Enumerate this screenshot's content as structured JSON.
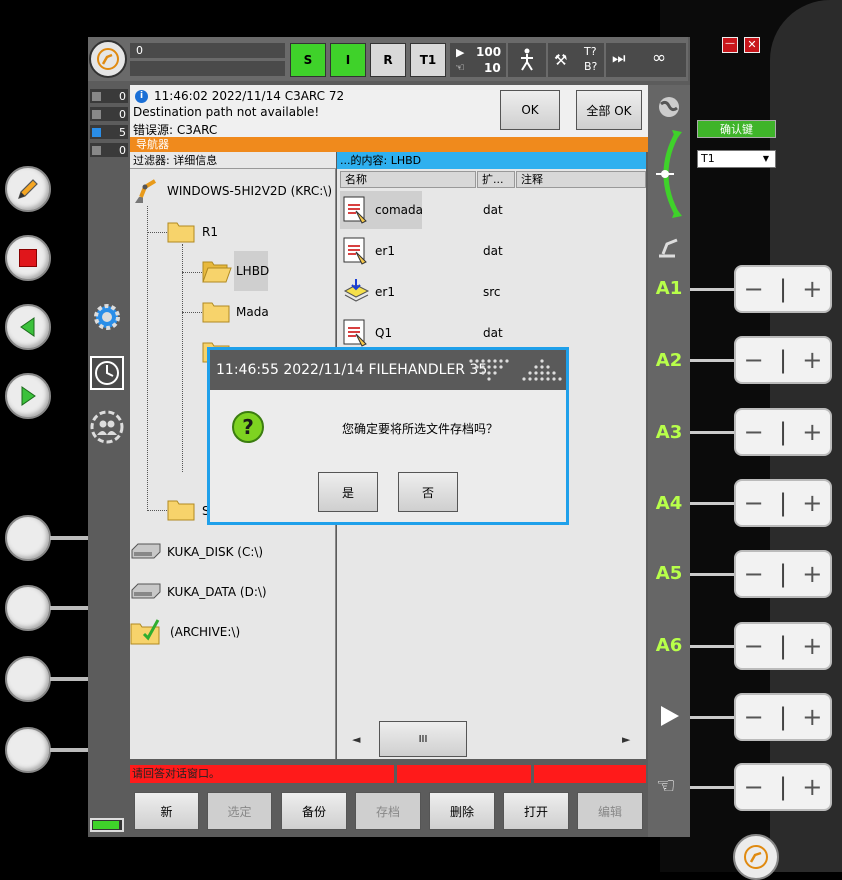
{
  "topbar": {
    "prog_field": "0",
    "btn_s": "S",
    "btn_i": "I",
    "btn_r": "R",
    "btn_t1": "T1",
    "override_prog": "100",
    "override_jog": "10",
    "tool_t": "T?",
    "tool_b": "B?",
    "infinity": "∞"
  },
  "counters": [
    {
      "icon": "info-icon",
      "value": "0"
    },
    {
      "icon": "warning-icon",
      "value": "0"
    },
    {
      "icon": "info-blue-icon",
      "value": "5"
    },
    {
      "icon": "dialog-icon",
      "value": "0"
    }
  ],
  "message": {
    "line1": "11:46:02 2022/11/14 C3ARC 72",
    "line2": "Destination path not available!",
    "line3": "错误源: C3ARC",
    "ok": "OK",
    "ok_all": "全部 OK"
  },
  "navigator": {
    "title": "导航器",
    "filter": "过滤器: 详细信息",
    "content": "...的内容: LHBD",
    "col_name": "名称",
    "col_ext": "扩...",
    "col_comment": "注释"
  },
  "tree": {
    "root": "WINDOWS-5HI2V2D (KRC:\\)",
    "r1": "R1",
    "lhbd": "LHBD",
    "mada": "Mada",
    "s_item": "S",
    "disk_c": "KUKA_DISK (C:\\)",
    "disk_d": "KUKA_DATA (D:\\)",
    "archive": "(ARCHIVE:\\)"
  },
  "files": [
    {
      "name": "comada",
      "ext": "dat"
    },
    {
      "name": "er1",
      "ext": "dat"
    },
    {
      "name": "er1",
      "ext": "src"
    },
    {
      "name": "Q1",
      "ext": "dat"
    }
  ],
  "scroll": {
    "thumb": "III",
    "left": "◄",
    "right": "►"
  },
  "status": {
    "text": "请回答对话窗口。"
  },
  "buttons": {
    "new": "新",
    "select": "选定",
    "backup": "备份",
    "archive": "存档",
    "delete": "删除",
    "open": "打开",
    "edit": "编辑"
  },
  "dialog": {
    "title": "11:46:55 2022/11/14 FILEHANDLER 35",
    "question": "您确定要将所选文件存档吗？",
    "yes": "是",
    "no": "否"
  },
  "right": {
    "confirm": "确认键",
    "mode": "T1",
    "axes": [
      "A1",
      "A2",
      "A3",
      "A4",
      "A5",
      "A6"
    ],
    "minus": "−",
    "plus": "+"
  },
  "colors": {
    "accent_orange": "#f08a1c",
    "accent_blue": "#2fb0ef",
    "green_btn": "#3fd22a",
    "status_red": "#ff1a1a",
    "axis_green": "#b8ff4a"
  }
}
